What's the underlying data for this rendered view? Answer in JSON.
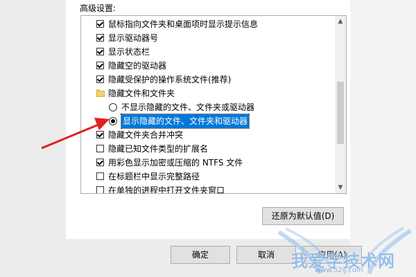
{
  "section_title": "高级设置:",
  "tree": {
    "items": [
      {
        "type": "checkbox",
        "checked": true,
        "label": "鼠标指向文件夹和桌面项时显示提示信息"
      },
      {
        "type": "checkbox",
        "checked": true,
        "label": "显示驱动器号"
      },
      {
        "type": "checkbox",
        "checked": true,
        "label": "显示状态栏"
      },
      {
        "type": "checkbox",
        "checked": true,
        "label": "隐藏空的驱动器"
      },
      {
        "type": "checkbox",
        "checked": true,
        "label": "隐藏受保护的操作系统文件(推荐)"
      },
      {
        "type": "folder",
        "label": "隐藏文件和文件夹"
      },
      {
        "type": "radio",
        "selected": false,
        "label": "不显示隐藏的文件、文件夹或驱动器"
      },
      {
        "type": "radio",
        "selected": true,
        "label": "显示隐藏的文件、文件夹和驱动器"
      },
      {
        "type": "checkbox",
        "checked": true,
        "label": "隐藏文件夹合并冲突"
      },
      {
        "type": "checkbox",
        "checked": false,
        "label": "隐藏已知文件类型的扩展名"
      },
      {
        "type": "checkbox",
        "checked": true,
        "label": "用彩色显示加密或压缩的 NTFS 文件"
      },
      {
        "type": "checkbox",
        "checked": false,
        "label": "在标题栏中显示完整路径"
      },
      {
        "type": "checkbox",
        "checked": false,
        "label": "在单独的进程中打开文件夹窗口"
      }
    ]
  },
  "buttons": {
    "restore_defaults": "还原为默认值(D)",
    "ok": "确定",
    "cancel": "取消",
    "apply": "应用(A)"
  },
  "watermark": {
    "text": "我爱学技术网",
    "url": "www.52ij.com"
  },
  "colors": {
    "selection": "#0078d7",
    "arrow": "#e02020"
  }
}
